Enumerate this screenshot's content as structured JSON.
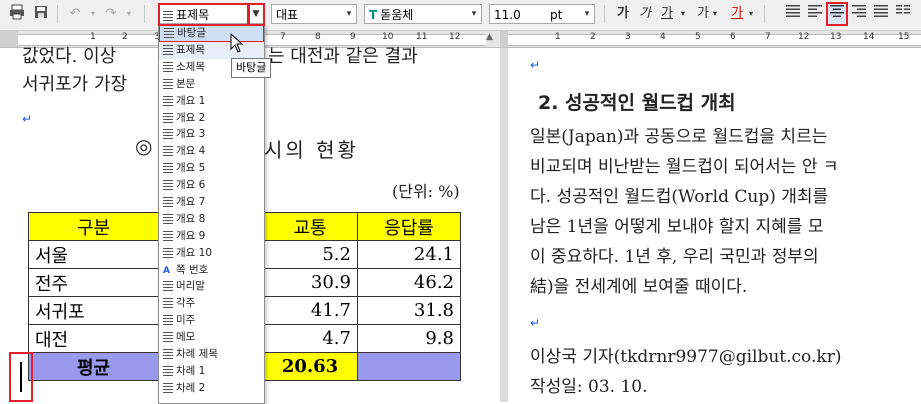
{
  "toolbar": {
    "style_combo": "표제목",
    "font_lang_combo": "대표",
    "font_combo": "돋움체",
    "font_size": "11.0",
    "size_unit": "pt",
    "bold": "가",
    "italic": "가",
    "underline": "가",
    "strike": "가",
    "font_color": "가",
    "icons": [
      "print-icon",
      "save-icon",
      "undo-icon",
      "redo-icon",
      "align-justify-icon",
      "align-left-icon",
      "align-center-icon",
      "align-right-icon",
      "distribute-icon",
      "split-icon"
    ]
  },
  "ruler": {
    "numbers": [
      "1",
      "2",
      "3",
      "4",
      "5",
      "6",
      "7",
      "8",
      "9",
      "10",
      "11",
      "12",
      "13",
      "14",
      "15"
    ]
  },
  "left_page": {
    "line1": "값었다. 이상",
    "line1b": "는 대전과 같은 결과",
    "line2": "서귀포가 가장",
    "heading_sym": "◎",
    "heading": "시의 현황",
    "unit": "(단위: %)",
    "table": {
      "headers": [
        "구분",
        "교통",
        "응답률"
      ],
      "rows": [
        {
          "city": "서울",
          "traffic": "5.2",
          "rate": "24.1"
        },
        {
          "city": "전주",
          "traffic": "30.9",
          "rate": "46.2"
        },
        {
          "city": "서귀포",
          "traffic": "41.7",
          "rate": "31.8"
        },
        {
          "city": "대전",
          "traffic": "4.7",
          "rate": "9.8"
        }
      ],
      "footer": {
        "label": "평균",
        "traffic": "20.63"
      }
    }
  },
  "right_page": {
    "heading": "2. 성공적인 월드컵 개최",
    "p1": "  일본(Japan)과 공동으로 월드컵을 치르는",
    "p2": "비교되며 비난받는 월드컵이 되어서는 안 ㅋ",
    "p3": "다. 성공적인 월드컵(World Cup) 개최를",
    "p4": "남은 1년을 어떻게 보내야 할지 지혜를 모",
    "p5": "이 중요하다. 1년 후, 우리 국민과 정부의",
    "p6": "結)을 전세계에 보여줄 때이다.",
    "author": "이상국 기자(tkdrnr9977@gilbut.co.kr)",
    "date": "작성일: 03. 10."
  },
  "dropdown": {
    "items": [
      "바탕글",
      "표제목",
      "소제목",
      "본문",
      "개요 1",
      "개요 2",
      "개요 3",
      "개요 4",
      "개요 5",
      "개요 6",
      "개요 7",
      "개요 8",
      "개요 9",
      "개요 10",
      "쪽 번호",
      "머리말",
      "각주",
      "미주",
      "메모",
      "차례 제목",
      "차례 1",
      "차례 2"
    ]
  },
  "tooltip": "바탕글",
  "colors": {
    "accent_red": "#e0212b",
    "table_header": "#ffff00",
    "table_footer": "#9999ee",
    "return_mark": "#1a5bd6"
  }
}
